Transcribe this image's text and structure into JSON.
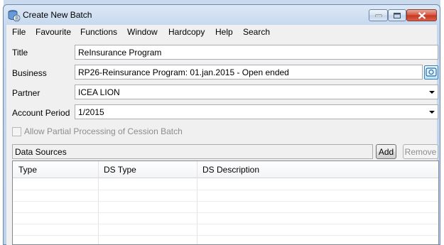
{
  "window": {
    "title": "Create New Batch"
  },
  "menu": [
    "File",
    "Favourite",
    "Functions",
    "Window",
    "Hardcopy",
    "Help",
    "Search"
  ],
  "form": {
    "title": {
      "label": "Title",
      "value": "ReInsurance Program"
    },
    "business": {
      "label": "Business",
      "value": "RP26-Reinsurance Program: 01.jan.2015  - Open ended"
    },
    "partner": {
      "label": "Partner",
      "value": "ICEA LION"
    },
    "account_period": {
      "label": "Account Period",
      "value": "1/2015"
    },
    "allow_partial": {
      "label": "Allow Partial Processing of Cession Batch",
      "checked": false,
      "enabled": false
    }
  },
  "data_sources": {
    "label": "Data Sources",
    "add_label": "Add",
    "remove_label": "Remove",
    "columns": [
      "Type",
      "DS Type",
      "DS Description"
    ],
    "rows": []
  },
  "icons": {
    "app": "batch-database-icon",
    "lookup": "search-lookup-icon",
    "minimize": "minimize-icon",
    "maximize": "maximize-icon",
    "close": "close-icon"
  },
  "colors": {
    "frame": "#c9daee",
    "client": "#f0f0f0",
    "close_button": "#c6361e"
  }
}
